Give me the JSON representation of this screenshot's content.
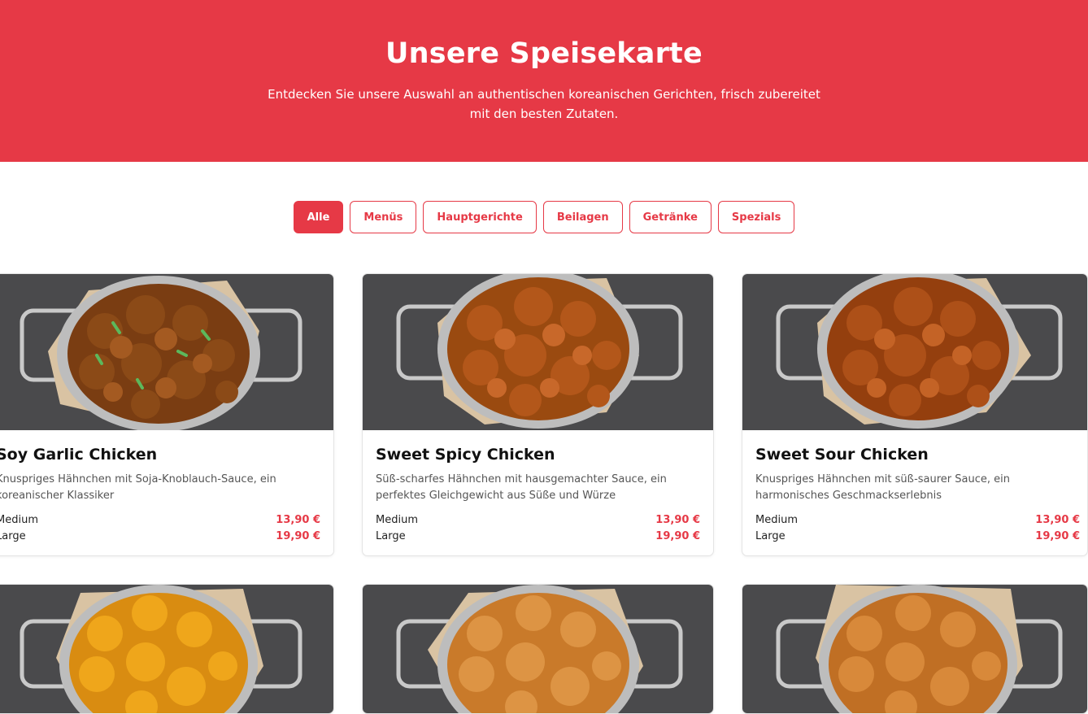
{
  "hero": {
    "title": "Unsere Speisekarte",
    "subtitle": "Entdecken Sie unsere Auswahl an authentischen koreanischen Gerichten, frisch zubereitet mit den besten Zutaten."
  },
  "filters": [
    "Alle",
    "Menüs",
    "Hauptgerichte",
    "Beilagen",
    "Getränke",
    "Spezials"
  ],
  "active_filter": "Alle",
  "colors": {
    "accent": "#e63946",
    "bowl_bg": "#4a4a4c"
  },
  "items": [
    {
      "name": "Soy Garlic Chicken",
      "description": "Knuspriges Hähnchen mit Soja-Knoblauch-Sauce, ein koreanischer Klassiker",
      "sizes": [
        {
          "label": "Medium",
          "price": "13,90 €"
        },
        {
          "label": "Large",
          "price": "19,90 €"
        }
      ]
    },
    {
      "name": "Sweet Spicy Chicken",
      "description": "Süß-scharfes Hähnchen mit hausgemachter Sauce, ein perfektes Gleichgewicht aus Süße und Würze",
      "sizes": [
        {
          "label": "Medium",
          "price": "13,90 €"
        },
        {
          "label": "Large",
          "price": "19,90 €"
        }
      ]
    },
    {
      "name": "Sweet Sour Chicken",
      "description": "Knuspriges Hähnchen mit süß-saurer Sauce, ein harmonisches Geschmackserlebnis",
      "sizes": [
        {
          "label": "Medium",
          "price": "13,90 €"
        },
        {
          "label": "Large",
          "price": "19,90 €"
        }
      ]
    }
  ]
}
